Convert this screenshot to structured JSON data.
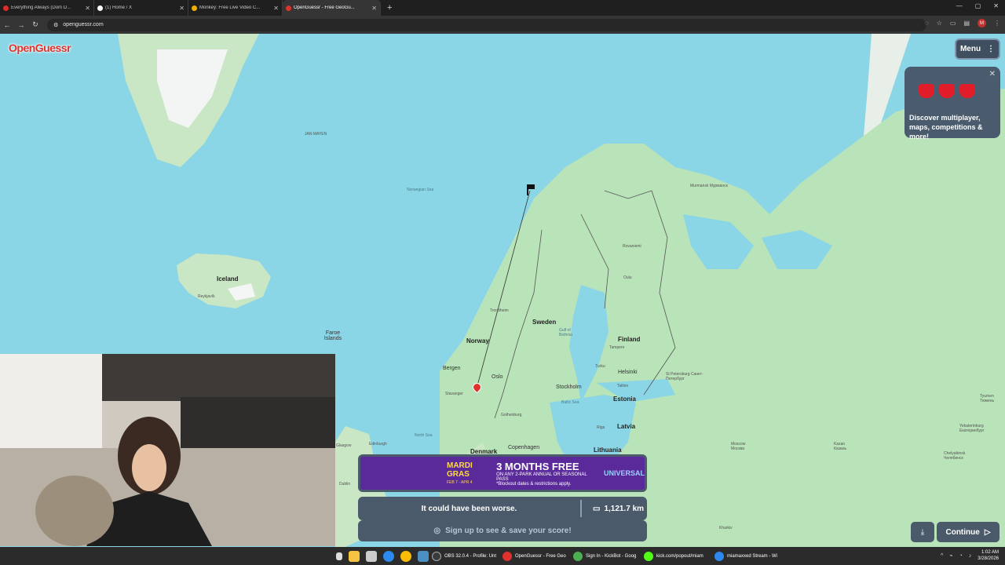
{
  "browser": {
    "tabs": [
      {
        "title": "Everything Always (Dom D...",
        "favicon_color": "#e02b2b"
      },
      {
        "title": "(1) Home / X",
        "favicon_color": "#ffffff"
      },
      {
        "title": "Monkey: Free Live Video C...",
        "favicon_color": "#f0b000"
      },
      {
        "title": "OpenGuessr - Free GeoGu...",
        "favicon_color": "#e0322c"
      }
    ],
    "new_tab": "+",
    "url": "openguessr.com",
    "avatar_letter": "M"
  },
  "game": {
    "logo": "OpenGuessr",
    "menu_label": "Menu",
    "promo_text": "Discover multiplayer, maps, competitions & more!",
    "result_message": "It could have been worse.",
    "distance": "1,121.7 km",
    "signup_text": "Sign up to see & save your score!",
    "continue_label": "Continue"
  },
  "ad": {
    "brand1": "MARDI GRAS",
    "dates": "FEB 7 - APR 4",
    "headline": "3 MONTHS FREE",
    "subline": "ON ANY 2-PARK ANNUAL OR SEASONAL PASS",
    "note": "*Blockout dates & restrictions apply.",
    "brand2": "UNIVERSAL"
  },
  "map": {
    "labels": {
      "iceland": "Iceland",
      "faroe": "Faroe Islands",
      "norway": "Norway",
      "sweden": "Sweden",
      "finland": "Finland",
      "estonia": "Estonia",
      "latvia": "Latvia",
      "lithuania": "Lithuania",
      "denmark": "Denmark",
      "jan_mayen": "JAN MAYEN",
      "bergen": "Bergen",
      "stavanger": "Stavanger",
      "oslo": "Oslo",
      "stockholm": "Stockholm",
      "helsinki": "Helsinki",
      "tallinn": "Tallinn",
      "riga": "Riga",
      "copenhagen": "Copenhagen",
      "gothenburg": "Gothenburg",
      "st_petersburg": "St Petersburg Санкт-Петербург",
      "moscow": "Moscow Москва",
      "murmansk": "Murmansk Мурманск",
      "oulu": "Oulu",
      "tampere": "Tampere",
      "turku": "Turku",
      "reykjavik": "Reykjavík",
      "edinburgh": "Edinburgh",
      "glasgow": "Glasgow",
      "dublin": "Dublin",
      "kazan": "Kazan Казань",
      "norwegian_sea": "Norwegian Sea",
      "north_sea": "North Sea",
      "baltic_sea": "Baltic Sea",
      "gulf_bothnia": "Gulf of Bothnia",
      "trondheim": "Trondheim",
      "rovaniemi": "Rovaniemi",
      "yekaterinburg": "Yekaterinburg Екатеринбург",
      "tyumen": "Tyumen Тюмень",
      "chelyabinsk": "Chelyabinsk Челябинск",
      "kharkiv": "Kharkiv"
    }
  },
  "taskbar": {
    "apps": [
      {
        "label": "OBS 32.0.4 - Profile: Unt",
        "color": "#3a3a3a"
      },
      {
        "label": "OpenGuessr - Free Geo",
        "color": "#e0322c"
      },
      {
        "label": "Sign In - KickBot - Goog",
        "color": "#4caf50"
      },
      {
        "label": "kick.com/popout/miam",
        "color": "#53fc18"
      },
      {
        "label": "miamaxxed Stream - Wi",
        "color": "#2d89ef"
      }
    ],
    "time": "1:02 AM",
    "date": "3/28/2026"
  }
}
